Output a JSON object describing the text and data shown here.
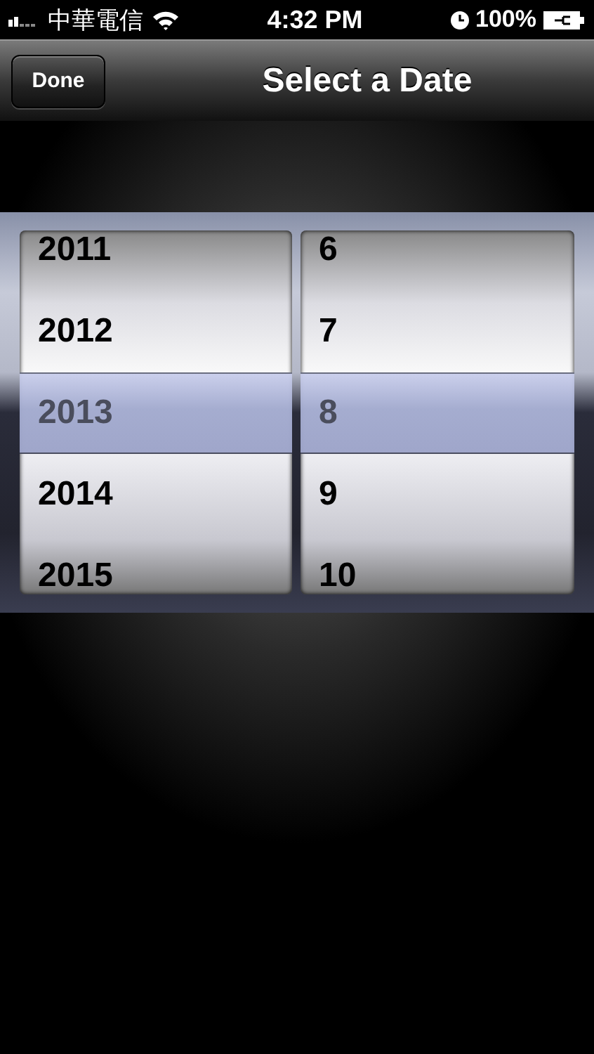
{
  "status_bar": {
    "carrier": "中華電信",
    "time": "4:32 PM",
    "battery": "100%"
  },
  "nav_bar": {
    "button": "Done",
    "title": "Select a Date"
  },
  "picker": {
    "columns": [
      {
        "items": [
          {
            "label": "2011",
            "selected": false
          },
          {
            "label": "2012",
            "selected": false
          },
          {
            "label": "2013",
            "selected": true
          },
          {
            "label": "2014",
            "selected": false
          },
          {
            "label": "2015",
            "selected": false
          }
        ]
      },
      {
        "items": [
          {
            "label": "6",
            "selected": false
          },
          {
            "label": "7",
            "selected": false
          },
          {
            "label": "8",
            "selected": true
          },
          {
            "label": "9",
            "selected": false
          },
          {
            "label": "10",
            "selected": false
          }
        ]
      }
    ]
  }
}
